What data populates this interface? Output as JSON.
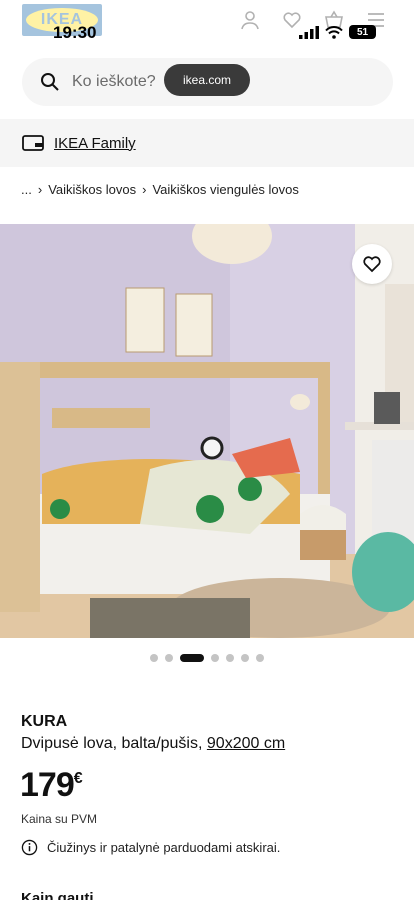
{
  "status_bar": {
    "time": "19:30",
    "battery": "51"
  },
  "header": {
    "logo_text": "IKEA"
  },
  "search": {
    "placeholder": "Ko ieškote?",
    "url": "ikea.com"
  },
  "family_banner": {
    "label": "IKEA Family"
  },
  "breadcrumb": {
    "ellipsis": "...",
    "items": [
      "Vaikiškos lovos",
      "Vaikiškos viengulės lovos"
    ]
  },
  "gallery": {
    "dot_count": 7,
    "active_index": 2
  },
  "product": {
    "name": "KURA",
    "description": "Dvipusė lova, balta/pušis,",
    "size": "90x200 cm",
    "price": "179",
    "currency": "€",
    "vat_note": "Kaina su PVM",
    "info_note": "Čiužinys ir patalynė parduodami atskirai."
  },
  "section": {
    "next_heading": "Kain gauti"
  },
  "colors": {
    "accent": "#0058a3",
    "brand_yellow": "#ffdb00",
    "pill": "#3a3a3a",
    "banner_bg": "#f5f5f5"
  }
}
